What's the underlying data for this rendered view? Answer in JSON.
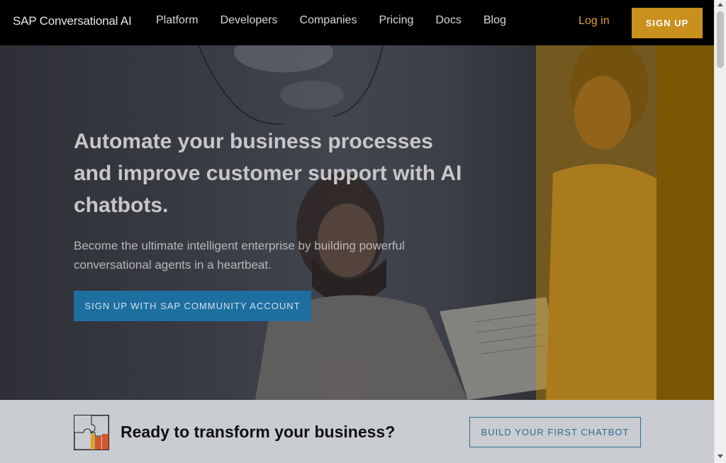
{
  "nav": {
    "brand": "SAP Conversational AI",
    "links": [
      "Platform",
      "Developers",
      "Companies",
      "Pricing",
      "Docs",
      "Blog"
    ],
    "login": "Log in",
    "signup": "SIGN UP"
  },
  "hero": {
    "headline": "Automate your business processes and improve customer support with AI chatbots.",
    "subline": "Become the ultimate intelligent enterprise by building powerful conversational agents in a heartbeat.",
    "cta": "SIGN UP WITH SAP COMMUNITY ACCOUNT"
  },
  "band": {
    "icon": "puzzle-icon",
    "title": "Ready to transform your business?",
    "cta": "BUILD YOUR FIRST CHATBOT"
  },
  "colors": {
    "nav_bg": "#000000",
    "accent_gold": "#c8901c",
    "cta_blue": "#1d6fa0"
  }
}
